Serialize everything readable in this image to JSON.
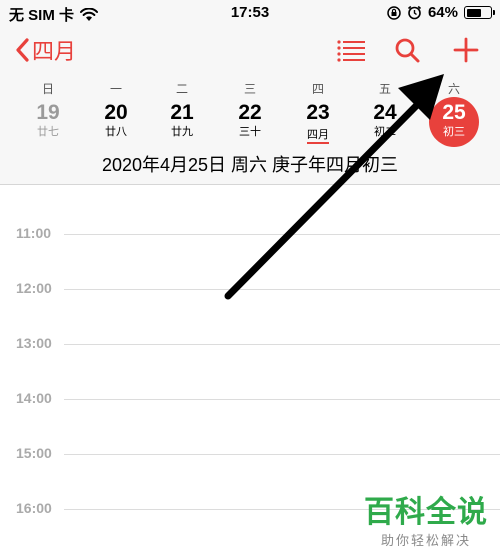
{
  "status_bar": {
    "carrier": "无 SIM 卡",
    "time": "17:53",
    "battery": "64%",
    "battery_level": 0.64
  },
  "nav": {
    "back_label": "四月",
    "accent_color": "#e8413c"
  },
  "week": {
    "weekdays": [
      "日",
      "一",
      "二",
      "三",
      "四",
      "五",
      "六"
    ],
    "days": [
      {
        "num": "19",
        "lunar": "廿七"
      },
      {
        "num": "20",
        "lunar": "廿八"
      },
      {
        "num": "21",
        "lunar": "廿九"
      },
      {
        "num": "22",
        "lunar": "三十"
      },
      {
        "num": "23",
        "lunar": "四月"
      },
      {
        "num": "24",
        "lunar": "初二"
      },
      {
        "num": "25",
        "lunar": "初三"
      }
    ]
  },
  "full_date": "2020年4月25日 周六   庚子年四月初三",
  "timeline": {
    "hours": [
      "11:00",
      "12:00",
      "13:00",
      "14:00",
      "15:00",
      "16:00"
    ]
  },
  "watermark": {
    "title": "百科全说",
    "subtitle": "助你轻松解决"
  }
}
